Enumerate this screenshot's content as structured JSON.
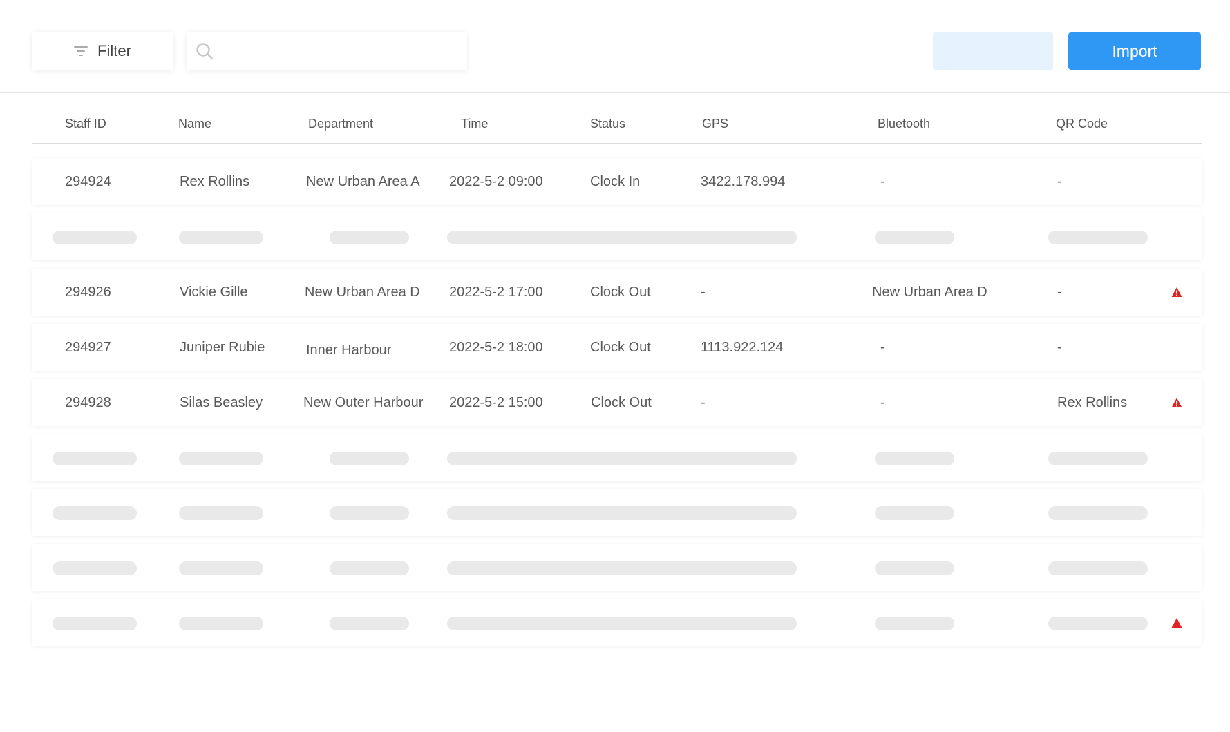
{
  "toolbar": {
    "filter_label": "Filter",
    "search_placeholder": "",
    "import_label": "Import",
    "filter_icon": "filter-icon",
    "search_icon": "search-icon"
  },
  "columns": [
    "Staff ID",
    "Name",
    "Department",
    "Time",
    "Status",
    "GPS",
    "Bluetooth",
    "QR Code"
  ],
  "rows": [
    {
      "id": "294924",
      "name": "Rex Rollins",
      "department": "New Urban Area A",
      "time": "2022-5-2 09:00",
      "status": "Clock In",
      "gps": "3422.178.994",
      "bluetooth": "-",
      "qr": "-",
      "warning": false
    },
    {
      "loading": true,
      "warning": false
    },
    {
      "id": "294926",
      "name": "Vickie Gille",
      "department": "New Urban Area D",
      "time": "2022-5-2 17:00",
      "status": "Clock Out",
      "gps": "-",
      "bluetooth": "New Urban Area D",
      "qr": "-",
      "warning": true
    },
    {
      "id": "294927",
      "name": "Juniper Rubie",
      "department": "Inner Harbour",
      "time": "2022-5-2 18:00",
      "status": "Clock Out",
      "gps": "1113.922.124",
      "bluetooth": "-",
      "qr": "-",
      "warning": false
    },
    {
      "id": "294928",
      "name": "Silas Beasley",
      "department": "New Outer Harbour",
      "time": "2022-5-2 15:00",
      "status": "Clock Out",
      "gps": "-",
      "bluetooth": "-",
      "qr": "Rex Rollins",
      "warning": true
    },
    {
      "loading": true,
      "warning": false
    },
    {
      "loading": true,
      "warning": false
    },
    {
      "loading": true,
      "warning": false
    },
    {
      "loading": true,
      "warning": true
    }
  ],
  "colors": {
    "accent": "#2f97f4",
    "accent_light": "#e6f3ff",
    "warning": "#e02424",
    "skeleton": "#e9e9e9"
  }
}
